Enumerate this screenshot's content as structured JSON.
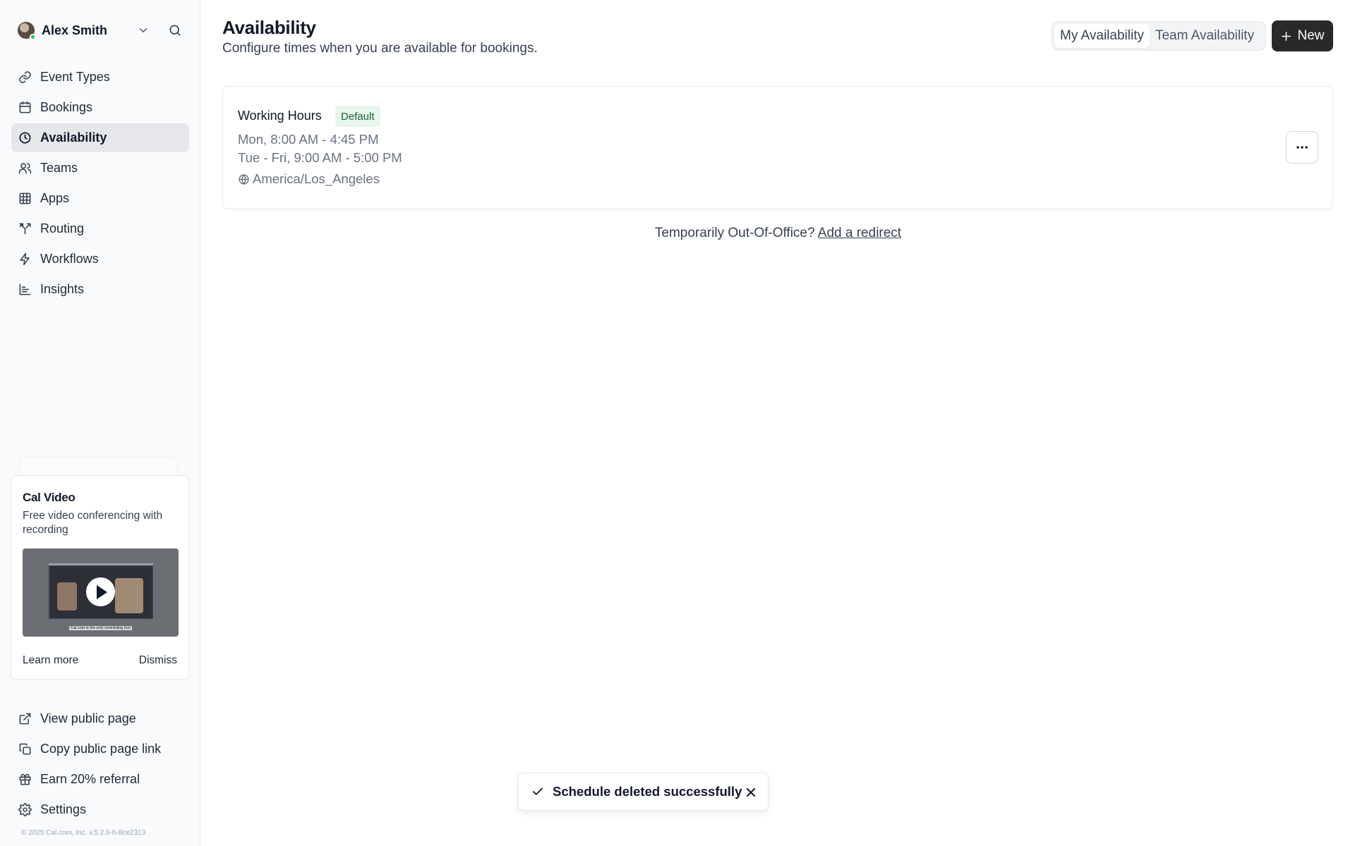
{
  "user": {
    "name": "Alex Smith"
  },
  "sidebar": {
    "items": [
      {
        "label": "Event Types",
        "icon": "link-icon"
      },
      {
        "label": "Bookings",
        "icon": "calendar-icon"
      },
      {
        "label": "Availability",
        "icon": "clock-icon",
        "active": true
      },
      {
        "label": "Teams",
        "icon": "users-icon"
      },
      {
        "label": "Apps",
        "icon": "grid-icon"
      },
      {
        "label": "Routing",
        "icon": "split-icon"
      },
      {
        "label": "Workflows",
        "icon": "zap-icon"
      },
      {
        "label": "Insights",
        "icon": "bar-chart-icon"
      }
    ],
    "bottom_items": [
      {
        "label": "View public page",
        "icon": "external-link-icon"
      },
      {
        "label": "Copy public page link",
        "icon": "copy-icon"
      },
      {
        "label": "Earn 20% referral",
        "icon": "gift-icon"
      },
      {
        "label": "Settings",
        "icon": "gear-icon"
      }
    ],
    "copyright": "© 2025 Cal.com, Inc. v.5.2.6-h-8ce2313"
  },
  "promo": {
    "title": "Cal Video",
    "description": "Free video conferencing with recording",
    "learn_more": "Learn more",
    "dismiss": "Dismiss",
    "thumb_caption": "Cal.com is the only scheduling tool"
  },
  "header": {
    "title": "Availability",
    "subtitle": "Configure times when you are available for bookings.",
    "toggle": {
      "my": "My Availability",
      "team": "Team Availability"
    },
    "new_label": "New"
  },
  "schedule": {
    "name": "Working Hours",
    "badge": "Default",
    "lines": [
      "Mon, 8:00 AM - 4:45 PM",
      "Tue - Fri, 9:00 AM - 5:00 PM"
    ],
    "timezone": "America/Los_Angeles"
  },
  "ooo": {
    "text": "Temporarily Out-Of-Office?",
    "link": "Add a redirect"
  },
  "toast": {
    "message": "Schedule deleted successfully"
  },
  "colors": {
    "primary_button": "#292929",
    "badge_bg": "#e8f6ee",
    "badge_text": "#166534",
    "online": "#22c55e"
  }
}
